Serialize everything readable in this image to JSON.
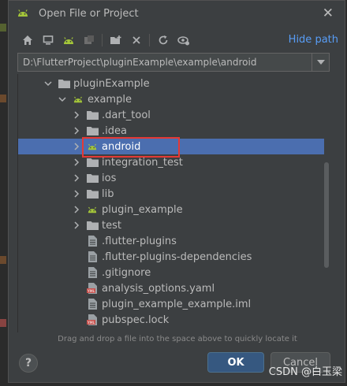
{
  "dialog": {
    "title": "Open File or Project",
    "close_icon": "close-icon"
  },
  "toolbar": {
    "buttons": [
      "home-icon",
      "desktop-icon",
      "android-project-icon",
      "module-icon",
      "new-folder-icon",
      "delete-icon",
      "refresh-icon",
      "show-hidden-icon"
    ],
    "hide_path_label": "Hide path"
  },
  "path": {
    "value": "D:\\FlutterProject\\pluginExample\\example\\android"
  },
  "tree": {
    "items": [
      {
        "label": "pluginExample",
        "chevron": "down",
        "icon": "folder"
      },
      {
        "label": "example",
        "chevron": "down",
        "icon": "android-folder"
      },
      {
        "label": ".dart_tool",
        "chevron": "right",
        "icon": "folder"
      },
      {
        "label": ".idea",
        "chevron": "right",
        "icon": "folder"
      },
      {
        "label": "android",
        "chevron": "right",
        "icon": "android-folder",
        "selected": true
      },
      {
        "label": "integration_test",
        "chevron": "right",
        "icon": "folder"
      },
      {
        "label": "ios",
        "chevron": "right",
        "icon": "folder"
      },
      {
        "label": "lib",
        "chevron": "right",
        "icon": "folder"
      },
      {
        "label": "plugin_example",
        "chevron": "right",
        "icon": "android-folder"
      },
      {
        "label": "test",
        "chevron": "right",
        "icon": "folder"
      },
      {
        "label": ".flutter-plugins",
        "chevron": "none",
        "icon": "file"
      },
      {
        "label": ".flutter-plugins-dependencies",
        "chevron": "none",
        "icon": "file"
      },
      {
        "label": ".gitignore",
        "chevron": "none",
        "icon": "file"
      },
      {
        "label": "analysis_options.yaml",
        "chevron": "none",
        "icon": "yaml-file"
      },
      {
        "label": "plugin_example_example.iml",
        "chevron": "none",
        "icon": "file"
      },
      {
        "label": "pubspec.lock",
        "chevron": "none",
        "icon": "yaml-file"
      }
    ]
  },
  "hint": "Drag and drop a file into the space above to quickly locate it",
  "buttons": {
    "help": "?",
    "ok": "OK",
    "cancel": "Cancel"
  },
  "watermark": "CSDN @白玉梁",
  "colors": {
    "selection": "#4b6eaf",
    "link": "#589df6",
    "android_green": "#a4c639",
    "highlight_box": "#e53935"
  }
}
